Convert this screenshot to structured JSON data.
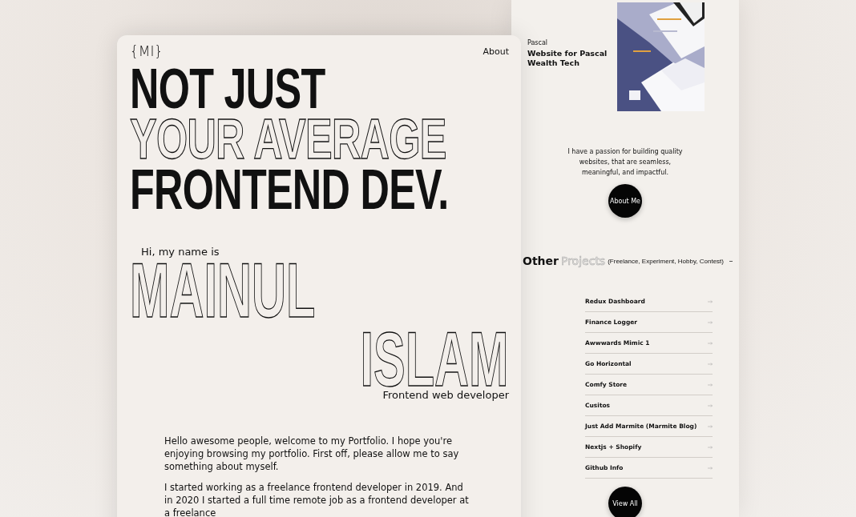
{
  "main_page": {
    "logo": "{MI}",
    "nav": [
      {
        "label": "About"
      }
    ],
    "headline": [
      "NOT JUST",
      "YOUR AVERAGE",
      "FRONTEND DEV."
    ],
    "greeting": "Hi, my name is",
    "name": [
      "MAINUL",
      "ISLAM"
    ],
    "role": "Frontend web developer",
    "paragraphs": [
      "Hello awesome people, welcome to my Portfolio. I hope you're enjoying browsing my portfolio. First off, please allow me to say something about myself.",
      "I started working as a freelance frontend developer in 2019. And in 2020 I started a full time remote job as a frontend developer at a freelance"
    ]
  },
  "second_page": {
    "featured": {
      "client": "Pascal",
      "title": "Website for Pascal Wealth Tech"
    },
    "passion": "I have a passion for building quality websites, that are seamless, meaningful, and impactful.",
    "about_button": "About Me",
    "section": {
      "title_solid": "Other",
      "title_outline": "Projects",
      "note": "(Freelance, Experiment, Hobby, Contest)"
    },
    "projects": [
      {
        "name": "Redux Dashboard"
      },
      {
        "name": "Finance Logger"
      },
      {
        "name": "Awwwards Mimic 1"
      },
      {
        "name": "Go Horizontal"
      },
      {
        "name": "Comfy Store"
      },
      {
        "name": "Cusitos"
      },
      {
        "name": "Just Add Marmite (Marmite Blog)"
      },
      {
        "name": "Nextjs + Shopify"
      },
      {
        "name": "Github Info"
      }
    ],
    "view_all": "View All"
  }
}
